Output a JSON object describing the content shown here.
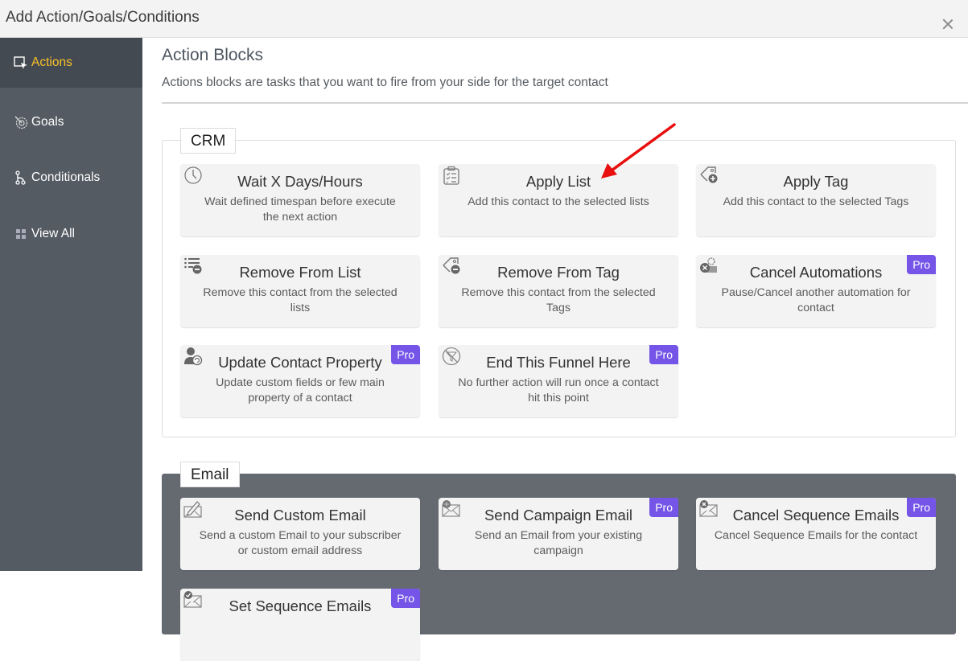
{
  "header": {
    "title": "Add Action/Goals/Conditions",
    "close_icon": "close-icon"
  },
  "sidebar": {
    "items": [
      {
        "label": "Actions",
        "icon": "actions-icon",
        "active": true
      },
      {
        "label": "Goals",
        "icon": "goals-icon",
        "active": false
      },
      {
        "label": "Conditionals",
        "icon": "conditionals-icon",
        "active": false
      },
      {
        "label": "View All",
        "icon": "grid-icon",
        "active": false
      }
    ]
  },
  "main": {
    "title": "Action Blocks",
    "subtitle": "Actions blocks are tasks that you want to fire from your side for the target contact"
  },
  "groups": {
    "crm": {
      "label": "CRM",
      "cards": [
        {
          "title": "Wait X Days/Hours",
          "desc": "Wait defined timespan before execute the next action",
          "icon": "clock-icon",
          "pro": false
        },
        {
          "title": "Apply List",
          "desc": "Add this contact to the selected lists",
          "icon": "clipboard-list-icon",
          "pro": false
        },
        {
          "title": "Apply Tag",
          "desc": "Add this contact to the selected Tags",
          "icon": "tag-add-icon",
          "pro": false
        },
        {
          "title": "Remove From List",
          "desc": "Remove this contact from the selected lists",
          "icon": "list-remove-icon",
          "pro": false
        },
        {
          "title": "Remove From Tag",
          "desc": "Remove this contact from the selected Tags",
          "icon": "tag-remove-icon",
          "pro": false
        },
        {
          "title": "Cancel Automations",
          "desc": "Pause/Cancel another automation for contact",
          "icon": "cancel-automation-icon",
          "pro": true
        },
        {
          "title": "Update Contact Property",
          "desc": "Update custom fields or few main property of a contact",
          "icon": "user-update-icon",
          "pro": true
        },
        {
          "title": "End This Funnel Here",
          "desc": "No further action will run once a contact hit this point",
          "icon": "funnel-stop-icon",
          "pro": true
        }
      ]
    },
    "email": {
      "label": "Email",
      "cards": [
        {
          "title": "Send Custom Email",
          "desc": "Send a custom Email to your subscriber or custom email address",
          "icon": "email-edit-icon",
          "pro": false
        },
        {
          "title": "Send Campaign Email",
          "desc": "Send an Email from your existing campaign",
          "icon": "email-campaign-icon",
          "pro": true
        },
        {
          "title": "Cancel Sequence Emails",
          "desc": "Cancel Sequence Emails for the contact",
          "icon": "email-cancel-icon",
          "pro": true
        },
        {
          "title": "Set Sequence Emails",
          "desc": "",
          "icon": "email-check-icon",
          "pro": true
        }
      ]
    }
  },
  "pro_label": "Pro",
  "colors": {
    "accent_active": "#f7c12a",
    "pro_badge": "#7455e8",
    "sidebar": "#545b63",
    "annotation_arrow": "#e8100f"
  }
}
